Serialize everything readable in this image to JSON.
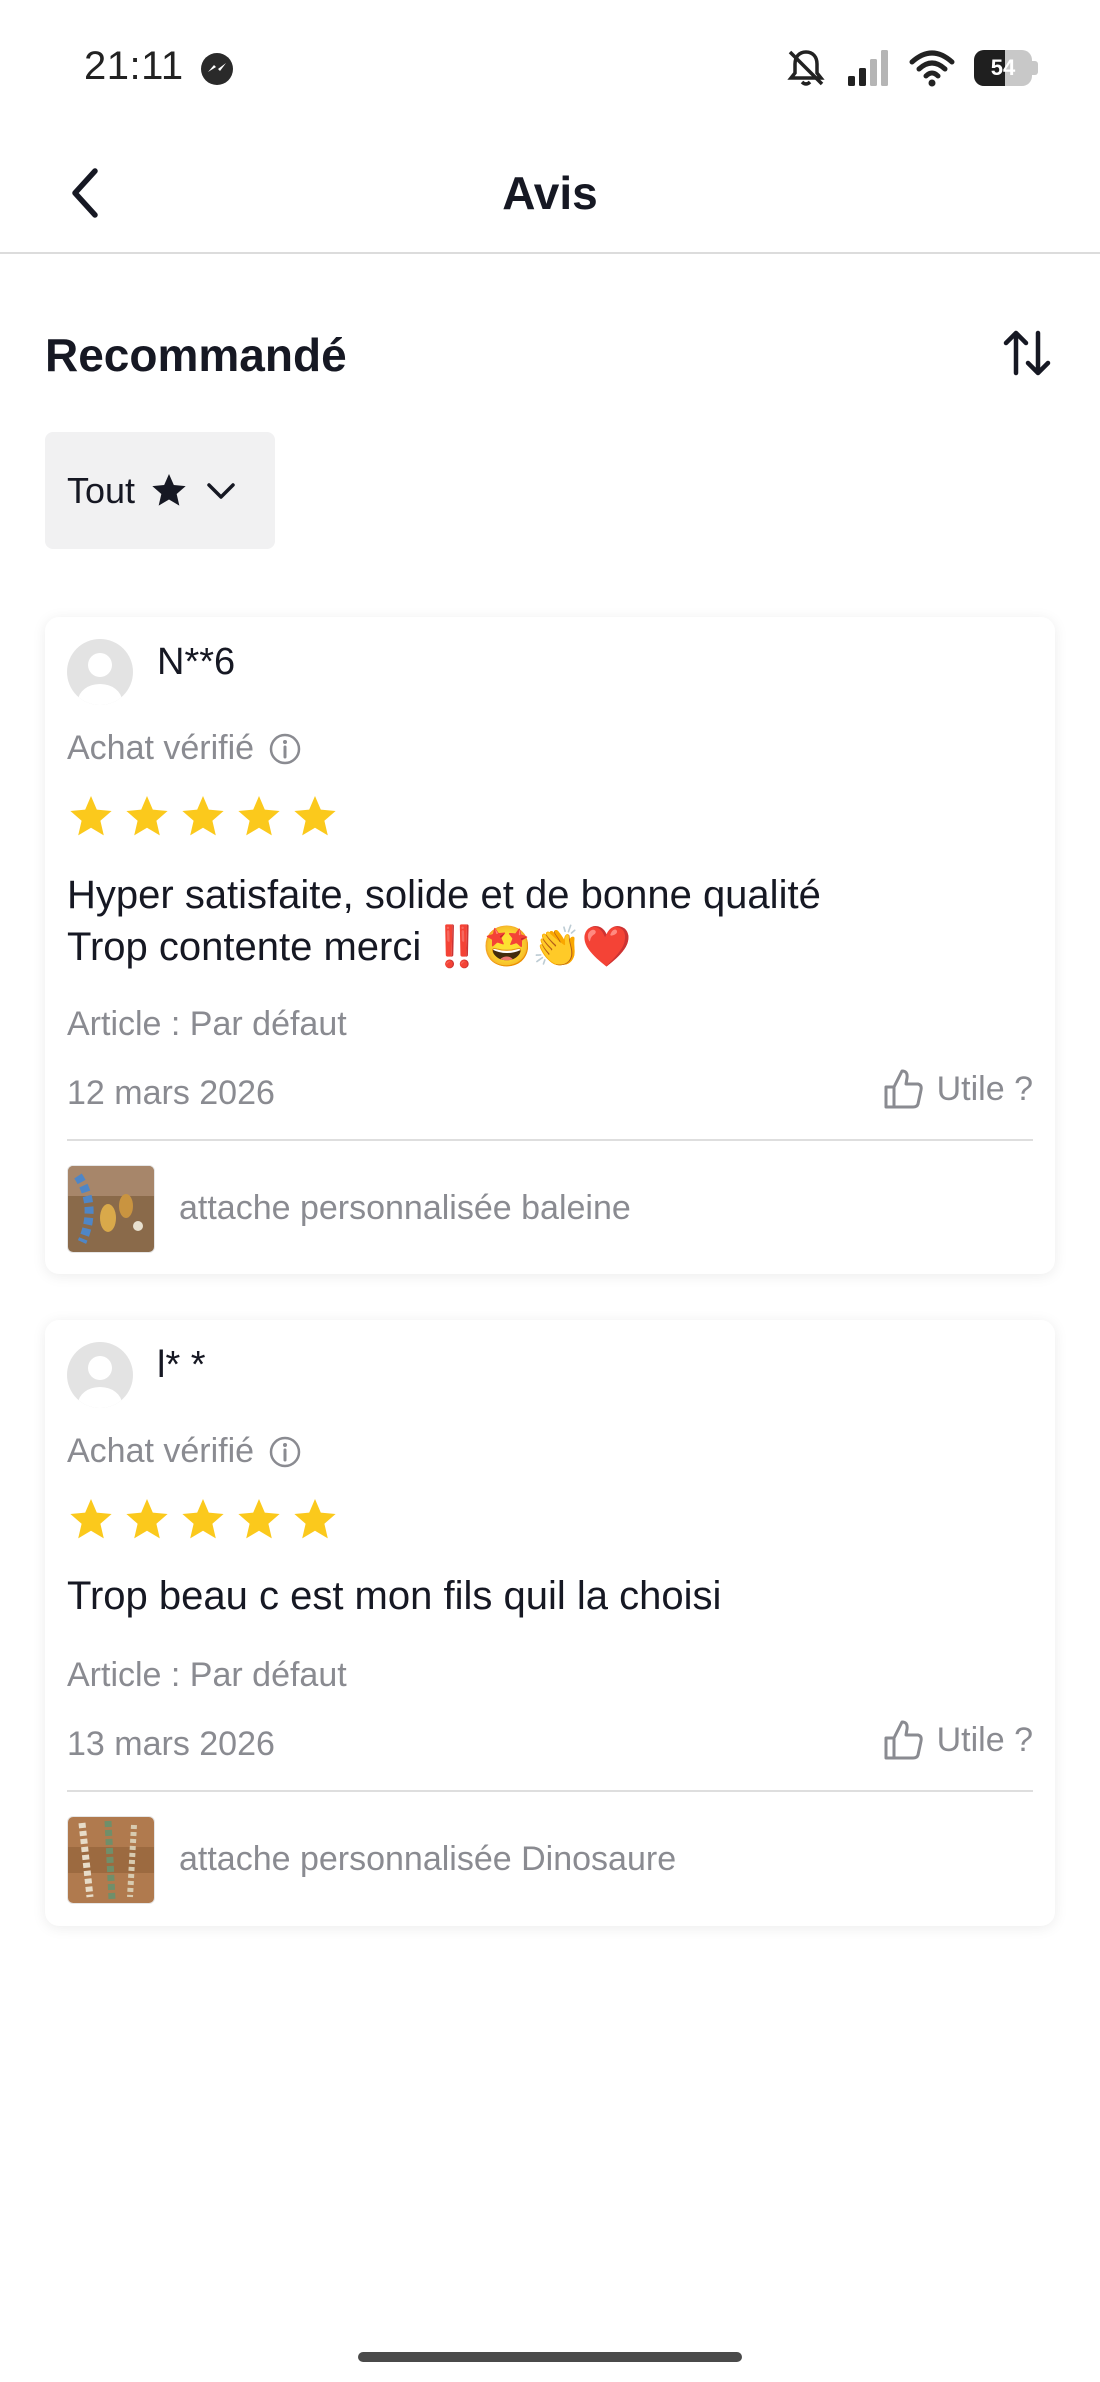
{
  "status_bar": {
    "time": "21:11",
    "battery_level": "54",
    "battery_fraction": 0.54,
    "icons": [
      "messenger-icon",
      "bell-off-icon",
      "signal-icon",
      "wifi-icon",
      "battery-icon"
    ]
  },
  "header": {
    "title": "Avis",
    "back_icon": "chevron-left-icon"
  },
  "filter_bar": {
    "section_title": "Recommandé",
    "sort_icon": "sort-arrows-icon",
    "rating_filter_label": "Tout",
    "rating_filter_icons": [
      "star-icon",
      "chevron-down-icon"
    ]
  },
  "colors": {
    "star": "#fbc91c",
    "text_primary": "#161823",
    "text_secondary": "#8a8b91",
    "divider": "#dedede",
    "chip_bg": "#f1f1f2"
  },
  "reviews": [
    {
      "username": "N**6",
      "verified_label": "Achat vérifié",
      "rating": 5,
      "text": "Hyper satisfaite, solide et de bonne qualité\nTrop contente merci ‼️🤩👏❤️",
      "article": "Article : Par défaut",
      "date": "12 mars 2026",
      "useful_label": "Utile ?",
      "product_name": "attache personnalisée baleine"
    },
    {
      "username": "l* *",
      "verified_label": "Achat vérifié",
      "rating": 5,
      "text": "Trop beau c est mon fils quil la choisi",
      "article": "Article : Par défaut",
      "date": "13 mars 2026",
      "useful_label": "Utile ?",
      "product_name": "attache personnalisée Dinosaure"
    }
  ]
}
